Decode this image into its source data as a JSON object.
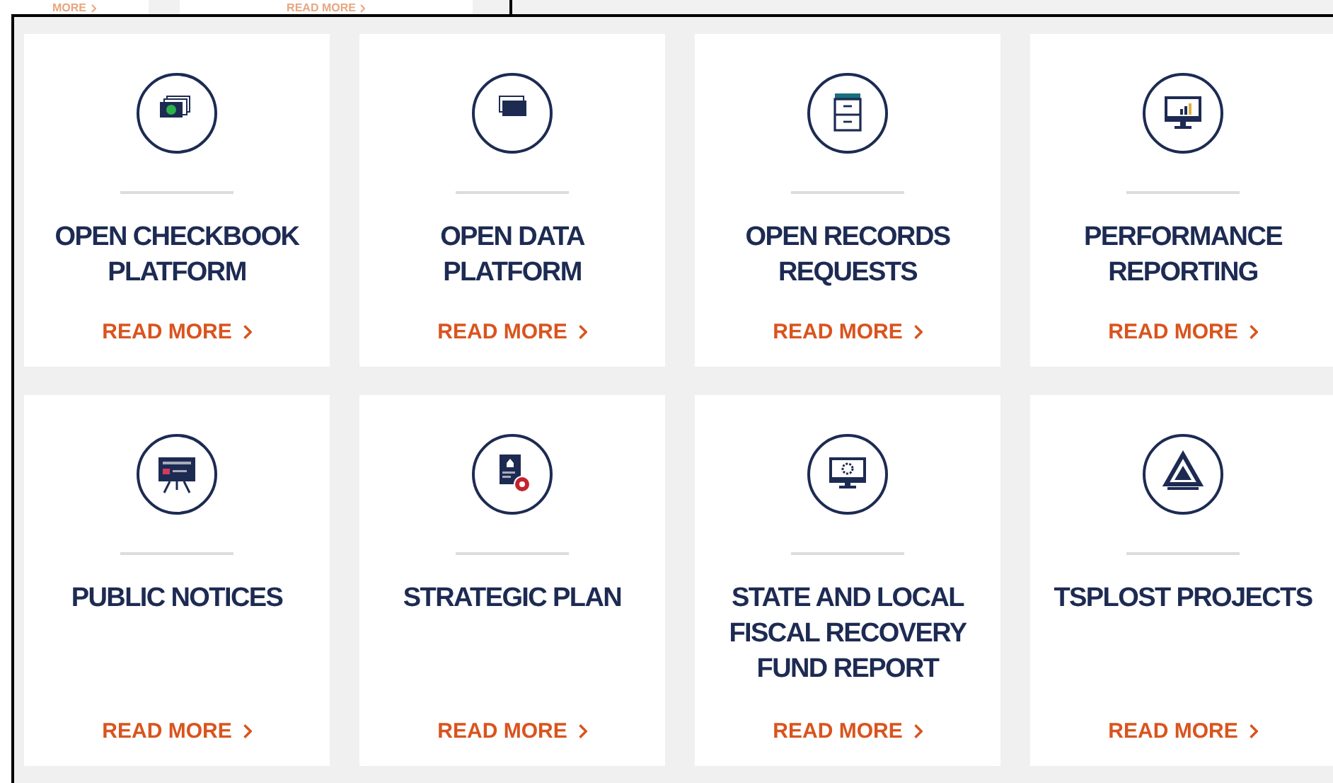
{
  "previous_strip": {
    "links": [
      "MORE",
      "READ MORE"
    ]
  },
  "cards": [
    {
      "title": "OPEN CHECKBOOK PLATFORM",
      "link": "READ MORE"
    },
    {
      "title": "OPEN DATA PLATFORM",
      "link": "READ MORE"
    },
    {
      "title": "OPEN RECORDS REQUESTS",
      "link": "READ MORE"
    },
    {
      "title": "PERFORMANCE REPORTING",
      "link": "READ MORE"
    },
    {
      "title": "PUBLIC NOTICES",
      "link": "READ MORE"
    },
    {
      "title": "STRATEGIC PLAN",
      "link": "READ MORE"
    },
    {
      "title": "STATE AND LOCAL FISCAL RECOVERY FUND REPORT",
      "link": "READ MORE"
    },
    {
      "title": "TSPLOST PROJECTS",
      "link": "READ MORE"
    }
  ]
}
